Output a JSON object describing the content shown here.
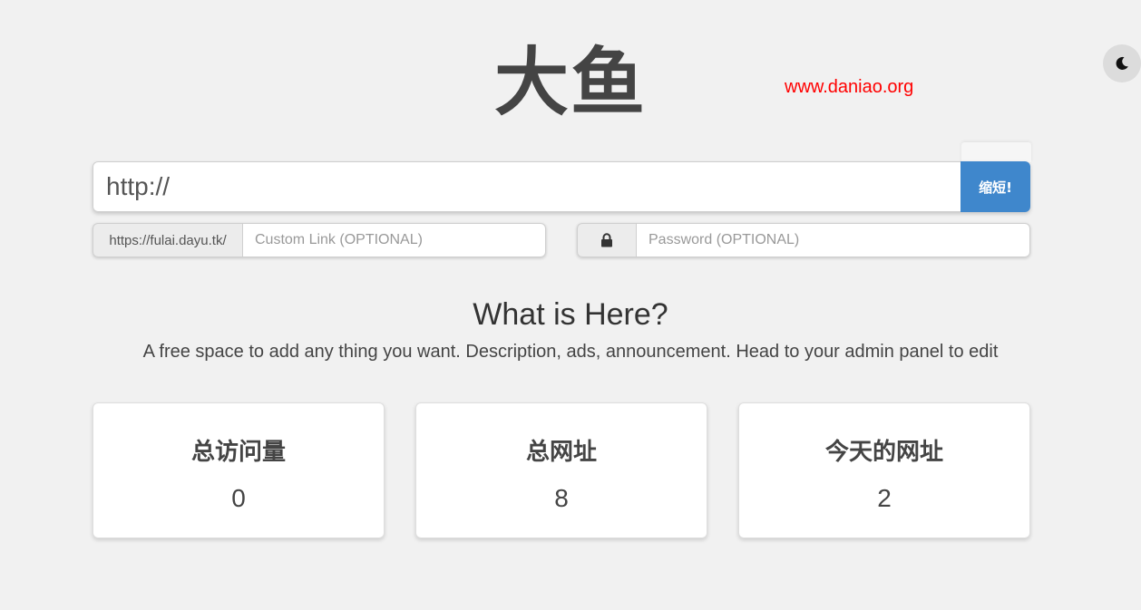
{
  "header": {
    "logo_text": "大鱼",
    "watermark": "www.daniao.org",
    "theme_toggle_icon": "moon-icon"
  },
  "shorten_form": {
    "url_value": "http://",
    "submit_label": "缩短!",
    "domain_prefix": "https://fulai.dayu.tk/",
    "custom_link_placeholder": "Custom Link (OPTIONAL)",
    "password_placeholder": "Password (OPTIONAL)",
    "password_icon": "lock-icon"
  },
  "info": {
    "title": "What is Here?",
    "text": "A free space to add any thing you want. Description, ads, announcement. Head to your admin panel to edit"
  },
  "stats": [
    {
      "label": "总访问量",
      "value": "0"
    },
    {
      "label": "总网址",
      "value": "8"
    },
    {
      "label": "今天的网址",
      "value": "2"
    }
  ],
  "colors": {
    "background": "#f1f1f1",
    "accent": "#3f87cc",
    "watermark": "#ff0000"
  }
}
